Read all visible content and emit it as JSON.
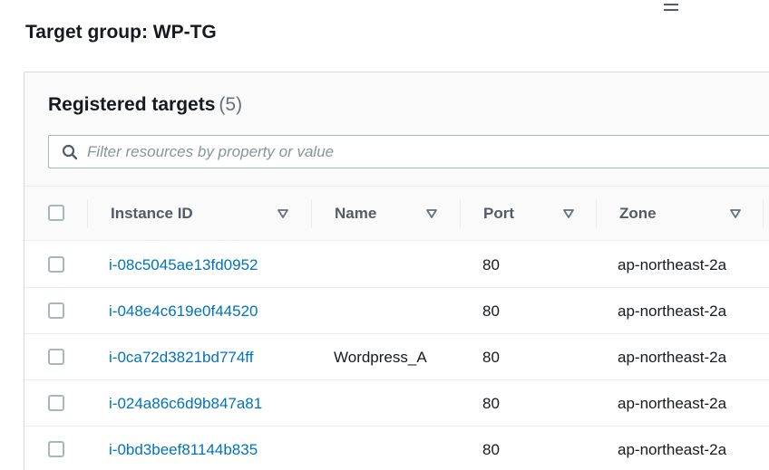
{
  "page": {
    "title": "Target group: WP-TG"
  },
  "icons": {
    "menu": "menu-icon",
    "search": "search-icon",
    "sort": "sort-down-icon"
  },
  "colors": {
    "link": "#0073bb",
    "header_bg": "#fafafa",
    "border": "#eaeded",
    "muted": "#687078"
  },
  "registered_targets": {
    "title": "Registered targets",
    "count": "(5)",
    "filter": {
      "placeholder": "Filter resources by property or value",
      "value": ""
    },
    "columns": [
      {
        "key": "instance_id",
        "label": "Instance ID"
      },
      {
        "key": "name",
        "label": "Name"
      },
      {
        "key": "port",
        "label": "Port"
      },
      {
        "key": "zone",
        "label": "Zone"
      }
    ],
    "rows": [
      {
        "instance_id": "i-08c5045ae13fd0952",
        "name": "",
        "port": "80",
        "zone": "ap-northeast-2a"
      },
      {
        "instance_id": "i-048e4c619e0f44520",
        "name": "",
        "port": "80",
        "zone": "ap-northeast-2a"
      },
      {
        "instance_id": "i-0ca72d3821bd774ff",
        "name": "Wordpress_A",
        "port": "80",
        "zone": "ap-northeast-2a"
      },
      {
        "instance_id": "i-024a86c6d9b847a81",
        "name": "",
        "port": "80",
        "zone": "ap-northeast-2a"
      },
      {
        "instance_id": "i-0bd3beef81144b835",
        "name": "",
        "port": "80",
        "zone": "ap-northeast-2a"
      }
    ]
  }
}
